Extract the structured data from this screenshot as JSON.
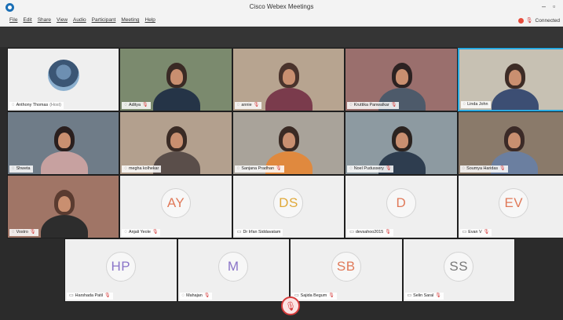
{
  "window": {
    "title": "Cisco Webex Meetings",
    "minimize": "–",
    "maximize": "▫"
  },
  "menu": [
    "File",
    "Edit",
    "Share",
    "View",
    "Audio",
    "Participant",
    "Meeting",
    "Help"
  ],
  "status": {
    "connected": "Connected"
  },
  "participants": [
    {
      "name": "Anthony Thomas",
      "tag": "(Host)",
      "type": "avatar",
      "muted": false
    },
    {
      "name": "Aditya",
      "type": "video",
      "muted": true
    },
    {
      "name": "annie",
      "type": "video",
      "muted": true
    },
    {
      "name": "Kruttika Panwalkar",
      "type": "video",
      "muted": true
    },
    {
      "name": "Linda John",
      "type": "video",
      "muted": false,
      "active": true
    },
    {
      "name": "Shweta",
      "type": "video",
      "muted": false
    },
    {
      "name": "megha kolhekar",
      "type": "video",
      "muted": false
    },
    {
      "name": "Sanjana Pradhan",
      "type": "video",
      "muted": true
    },
    {
      "name": "Noel Pudussery",
      "type": "video",
      "muted": true
    },
    {
      "name": "Soumya Haridas",
      "type": "video",
      "muted": true
    },
    {
      "name": "Vostro",
      "type": "video",
      "muted": true
    },
    {
      "name": "Anjali Yeole",
      "initials": "AY",
      "color": "#e07a5a",
      "type": "initials",
      "muted": true
    },
    {
      "name": "Dr Irfan Siddavatam",
      "initials": "DS",
      "color": "#e0a93a",
      "type": "initials",
      "muted": false
    },
    {
      "name": "devsahoo2015",
      "initials": "D",
      "color": "#e07a5a",
      "type": "initials",
      "muted": true
    },
    {
      "name": "Evan V",
      "initials": "EV",
      "color": "#e07a5a",
      "type": "initials",
      "muted": true
    },
    {
      "name": "Harshada Patil",
      "initials": "HP",
      "color": "#8a74c8",
      "type": "initials",
      "muted": true
    },
    {
      "name": "Mahajan",
      "initials": "M",
      "color": "#8a74c8",
      "type": "initials",
      "muted": true
    },
    {
      "name": "Sajida Begum",
      "initials": "SB",
      "color": "#e07a5a",
      "type": "initials",
      "muted": true
    },
    {
      "name": "Selin Saral",
      "initials": "SS",
      "color": "#7a7a7a",
      "type": "initials",
      "muted": true
    }
  ]
}
